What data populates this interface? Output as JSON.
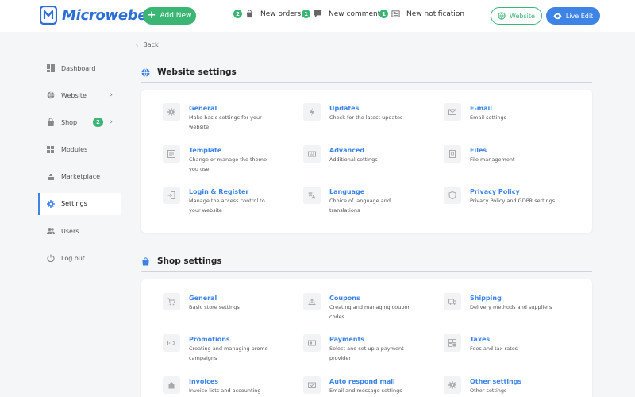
{
  "header": {
    "logo_text": "Microweber",
    "add_new_label": "Add New",
    "notifications": [
      {
        "count": "2",
        "label": "New orders",
        "icon": "shopping-bag-icon"
      },
      {
        "count": "1",
        "label": "New comment",
        "icon": "comment-icon"
      },
      {
        "count": "1",
        "label": "New notification",
        "icon": "newspaper-icon"
      }
    ],
    "website_label": "Website",
    "live_edit_label": "Live Edit",
    "accent_green": "#3bb573",
    "accent_blue": "#3d84e6"
  },
  "back_label": "Back",
  "sidebar": {
    "items": [
      {
        "label": "Dashboard",
        "icon": "dashboard-icon"
      },
      {
        "label": "Website",
        "icon": "globe-icon"
      },
      {
        "label": "Shop",
        "icon": "shopping-bag-icon",
        "badge": "2"
      },
      {
        "label": "Modules",
        "icon": "modules-icon"
      },
      {
        "label": "Marketplace",
        "icon": "marketplace-icon"
      },
      {
        "label": "Settings",
        "icon": "gear-icon",
        "active": true
      },
      {
        "label": "Users",
        "icon": "users-icon"
      },
      {
        "label": "Log out",
        "icon": "power-icon"
      }
    ]
  },
  "website_settings": {
    "title": "Website settings",
    "items": [
      {
        "title": "General",
        "desc": "Make basic settings for your website",
        "icon": "gear-icon"
      },
      {
        "title": "Updates",
        "desc": "Check for the latest updates",
        "icon": "flash-icon"
      },
      {
        "title": "E-mail",
        "desc": "Email settings",
        "icon": "email-icon"
      },
      {
        "title": "Template",
        "desc": "Change or manage the theme you use",
        "icon": "template-icon"
      },
      {
        "title": "Advanced",
        "desc": "Additional settings",
        "icon": "keyboard-icon"
      },
      {
        "title": "Files",
        "desc": "File management",
        "icon": "files-icon"
      },
      {
        "title": "Login & Register",
        "desc": "Manage the access control to your website",
        "icon": "login-icon"
      },
      {
        "title": "Language",
        "desc": "Choice of language and translations",
        "icon": "translate-icon"
      },
      {
        "title": "Privacy Policy",
        "desc": "Privacy Policy and GDPR settings",
        "icon": "shield-icon"
      }
    ]
  },
  "shop_settings": {
    "title": "Shop settings",
    "items": [
      {
        "title": "General",
        "desc": "Basic store settings",
        "icon": "cart-icon"
      },
      {
        "title": "Coupons",
        "desc": "Creating and managing coupon codes",
        "icon": "coupon-icon"
      },
      {
        "title": "Shipping",
        "desc": "Delivery methods and suppliers",
        "icon": "truck-icon"
      },
      {
        "title": "Promotions",
        "desc": "Creating and managing promo campaigns",
        "icon": "tag-icon"
      },
      {
        "title": "Payments",
        "desc": "Select and set up a payment provider",
        "icon": "payment-icon"
      },
      {
        "title": "Taxes",
        "desc": "Fees and tax rates",
        "icon": "taxes-icon"
      },
      {
        "title": "Invoices",
        "desc": "Invoice lists and accounting",
        "icon": "invoice-icon"
      },
      {
        "title": "Auto respond mail",
        "desc": "Email and message settings",
        "icon": "mail-check-icon"
      },
      {
        "title": "Other settings",
        "desc": "Other settings",
        "icon": "gear-icon"
      }
    ]
  }
}
